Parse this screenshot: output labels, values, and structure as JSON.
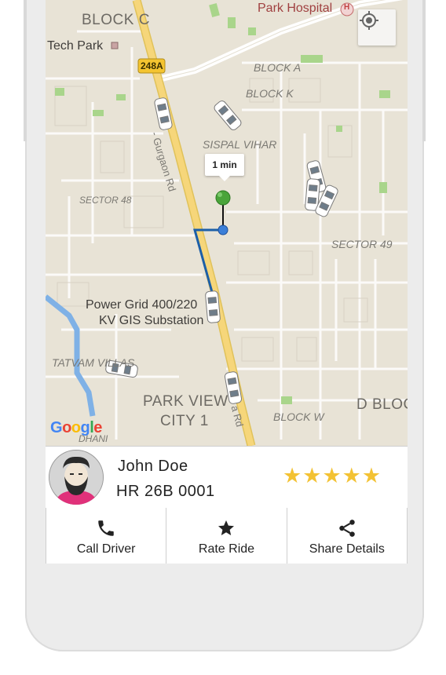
{
  "map": {
    "labels": {
      "block_c": "BLOCK C",
      "park_hospital": "Park Hospital",
      "hospital_badge": "H",
      "tech_park": "Tech Park",
      "route_badge": "248A",
      "block_a": "BLOCK A",
      "block_k": "BLOCK K",
      "sispal_vihar": "SISPAL VIHAR",
      "gurgaon_rd": "- Gurgaon Rd",
      "sector_48": "SECTOR 48",
      "sector_49": "SECTOR 49",
      "power_grid_line1": "Power Grid 400/220",
      "power_grid_line2": "KV GIS Substation",
      "tatvam_villas": "TATVAM VILLAS",
      "park_view_line1": "PARK VIEW",
      "park_view_line2": "CITY 1",
      "block_w": "BLOCK W",
      "d_block": "D BLOC",
      "dhani": "DHANI",
      "road_suffix": "a Rd"
    },
    "eta": "1 min",
    "google_logo": "Google",
    "locate_icon": "my-location-icon",
    "colors": {
      "background": "#e8e3d6",
      "highway": "#f6d67a",
      "route": "#1c5fa8",
      "destination_pin": "#4aa43a",
      "user_dot": "#3b7fd8",
      "water": "#7fb1e6",
      "park": "#a9d58b"
    }
  },
  "driver": {
    "name": "John Doe",
    "plate": "HR 26B 0001",
    "rating": 5,
    "stars": [
      "★",
      "★",
      "★",
      "★",
      "★"
    ],
    "avatar_icon": "bearded-man-avatar"
  },
  "actions": [
    {
      "label": "Call Driver",
      "icon": "phone-icon"
    },
    {
      "label": "Rate Ride",
      "icon": "star-icon"
    },
    {
      "label": "Share Details",
      "icon": "share-icon"
    }
  ]
}
